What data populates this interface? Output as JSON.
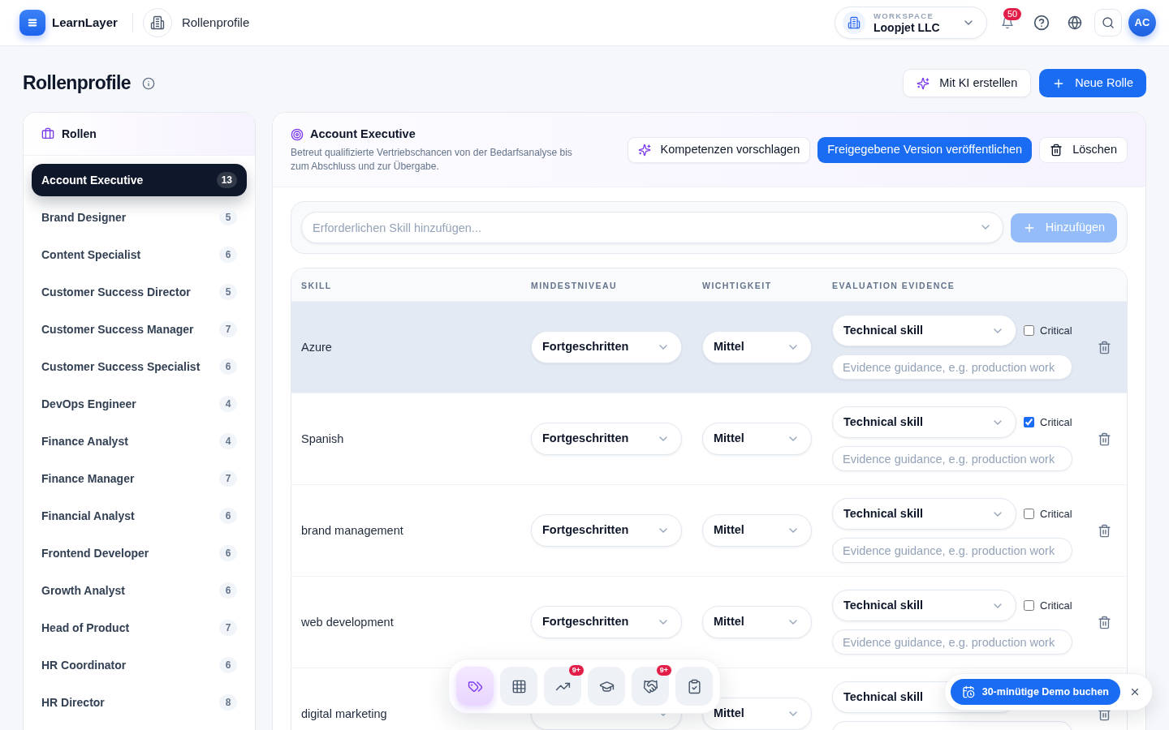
{
  "header": {
    "app_name": "LearnLayer",
    "breadcrumb": "Rollenprofile",
    "workspace": {
      "label": "WORKSPACE",
      "name": "Loopjet LLC"
    },
    "notification_count": "50",
    "avatar_initials": "AC"
  },
  "page": {
    "title": "Rollenprofile",
    "actions": [
      {
        "kind": "ai",
        "label": "Mit KI erstellen"
      },
      {
        "kind": "create",
        "label": "Neue Rolle"
      }
    ]
  },
  "sidebar": {
    "title": "Rollen",
    "items": [
      {
        "label": "Account Executive",
        "count": "13",
        "selected": true
      },
      {
        "label": "Brand Designer",
        "count": "5",
        "selected": false
      },
      {
        "label": "Content Specialist",
        "count": "6",
        "selected": false
      },
      {
        "label": "Customer Success Director",
        "count": "5",
        "selected": false
      },
      {
        "label": "Customer Success Manager",
        "count": "7",
        "selected": false
      },
      {
        "label": "Customer Success Specialist",
        "count": "6",
        "selected": false
      },
      {
        "label": "DevOps Engineer",
        "count": "4",
        "selected": false
      },
      {
        "label": "Finance Analyst",
        "count": "4",
        "selected": false
      },
      {
        "label": "Finance Manager",
        "count": "7",
        "selected": false
      },
      {
        "label": "Financial Analyst",
        "count": "6",
        "selected": false
      },
      {
        "label": "Frontend Developer",
        "count": "6",
        "selected": false
      },
      {
        "label": "Growth Analyst",
        "count": "6",
        "selected": false
      },
      {
        "label": "Head of Product",
        "count": "7",
        "selected": false
      },
      {
        "label": "HR Coordinator",
        "count": "6",
        "selected": false
      },
      {
        "label": "HR Director",
        "count": "8",
        "selected": false
      }
    ]
  },
  "role": {
    "title": "Account Executive",
    "description": "Betreut qualifizierte Vertriebschancen von der Bedarfsanalyse bis zum Abschluss und zur Übergabe.",
    "actions": [
      {
        "kind": "ai",
        "label": "Kompetenzen vorschlagen"
      },
      {
        "kind": "publish",
        "label": "Freigegebene Version veröffentlichen"
      },
      {
        "kind": "delete",
        "label": "Löschen"
      }
    ]
  },
  "add_skill": {
    "placeholder": "Erforderlichen Skill hinzufügen...",
    "button": "Hinzufügen",
    "disabled": true
  },
  "table": {
    "columns": [
      "SKILL",
      "MINDESTNIVEAU",
      "WICHTIGKEIT",
      "EVALUATION EVIDENCE"
    ],
    "rows": [
      {
        "skill": "Azure",
        "minimum_level": "Fortgeschritten",
        "importance": "Mittel",
        "evidence_type": "Technical skill",
        "critical": false,
        "critical_label": "Critical",
        "guidance_placeholder": "Evidence guidance, e.g. production work",
        "highlighted": true
      },
      {
        "skill": "Spanish",
        "minimum_level": "Fortgeschritten",
        "importance": "Mittel",
        "evidence_type": "Technical skill",
        "critical": true,
        "critical_label": "Critical",
        "guidance_placeholder": "Evidence guidance, e.g. production work",
        "highlighted": false
      },
      {
        "skill": "brand management",
        "minimum_level": "Fortgeschritten",
        "importance": "Mittel",
        "evidence_type": "Technical skill",
        "critical": false,
        "critical_label": "Critical",
        "guidance_placeholder": "Evidence guidance, e.g. production work",
        "highlighted": false
      },
      {
        "skill": "web development",
        "minimum_level": "Fortgeschritten",
        "importance": "Mittel",
        "evidence_type": "Technical skill",
        "critical": false,
        "critical_label": "Critical",
        "guidance_placeholder": "Evidence guidance, e.g. production work",
        "highlighted": false
      },
      {
        "skill": "digital marketing",
        "importance": "Mittel",
        "evidence_type": "Technical skill",
        "highlighted": false
      }
    ]
  },
  "dock": {
    "items": [
      {
        "kind": "tags",
        "selected": true
      },
      {
        "kind": "grid",
        "selected": false
      },
      {
        "kind": "trend",
        "selected": false,
        "badge": "9+"
      },
      {
        "kind": "courses",
        "selected": false
      },
      {
        "kind": "deals",
        "selected": false,
        "badge": "9+"
      },
      {
        "kind": "tasks",
        "selected": false
      }
    ]
  },
  "demo_banner": {
    "label": "30-minütige Demo buchen"
  }
}
